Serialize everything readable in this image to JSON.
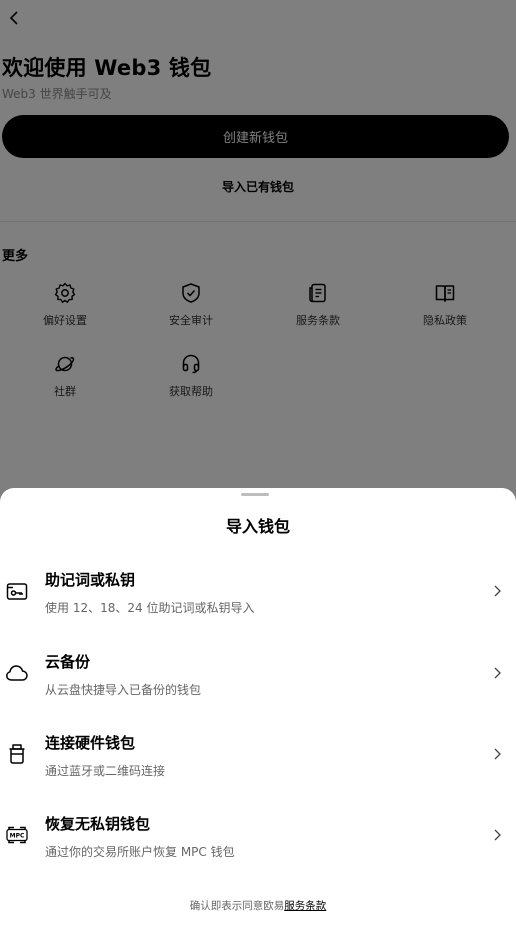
{
  "header": {
    "back_icon": "chevron-left-icon",
    "title": "欢迎使用 Web3 钱包",
    "subtitle": "Web3 世界触手可及"
  },
  "actions": {
    "create_label": "创建新钱包",
    "import_label": "导入已有钱包"
  },
  "more": {
    "title": "更多",
    "items": [
      {
        "label": "偏好设置",
        "icon": "gear-icon"
      },
      {
        "label": "安全审计",
        "icon": "shield-check-icon"
      },
      {
        "label": "服务条款",
        "icon": "document-icon"
      },
      {
        "label": "隐私政策",
        "icon": "book-icon"
      },
      {
        "label": "社群",
        "icon": "planet-icon"
      },
      {
        "label": "获取帮助",
        "icon": "headset-icon"
      }
    ]
  },
  "sheet": {
    "title": "导入钱包",
    "options": [
      {
        "title": "助记词或私钥",
        "desc": "使用 12、18、24 位助记词或私钥导入",
        "icon": "key-card-icon"
      },
      {
        "title": "云备份",
        "desc": "从云盘快捷导入已备份的钱包",
        "icon": "cloud-icon"
      },
      {
        "title": "连接硬件钱包",
        "desc": "通过蓝牙或二维码连接",
        "icon": "hardware-wallet-icon"
      },
      {
        "title": "恢复无私钥钱包",
        "desc": "通过你的交易所账户恢复 MPC 钱包",
        "icon": "mpc-icon"
      }
    ],
    "footer_text": "确认即表示同意欧易",
    "footer_link": "服务条款",
    "mpc_icon_text": "MPC"
  }
}
